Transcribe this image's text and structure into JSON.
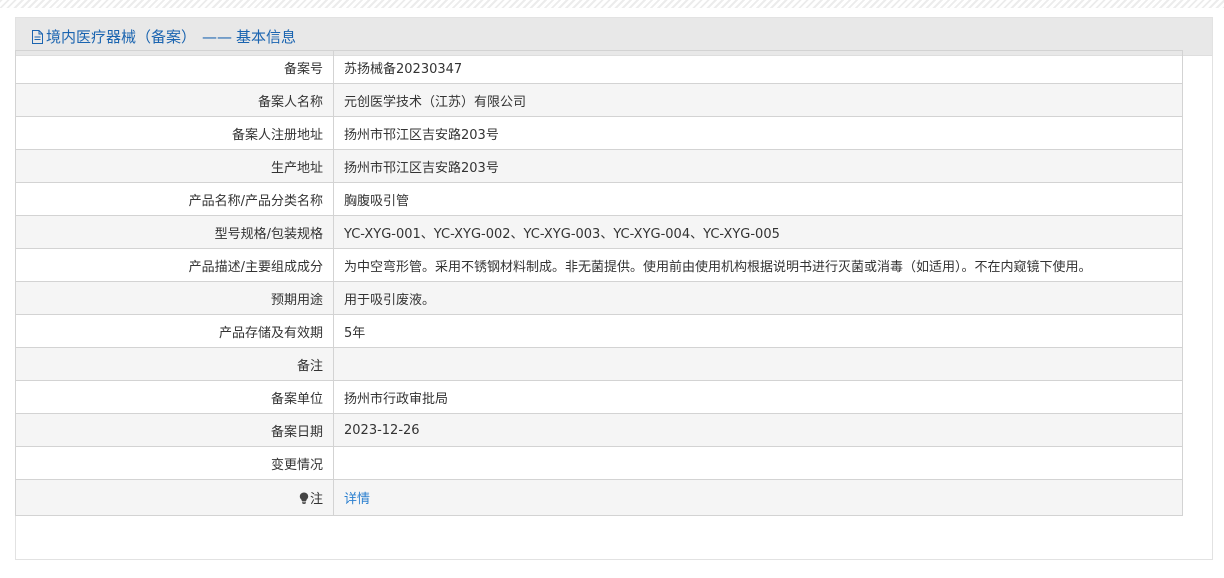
{
  "header": {
    "title": "境内医疗器械（备案）",
    "separator": "——",
    "subtitle": "基本信息"
  },
  "rows": [
    {
      "label": "备案号",
      "value": "苏扬械备20230347"
    },
    {
      "label": "备案人名称",
      "value": "元创医学技术（江苏）有限公司"
    },
    {
      "label": "备案人注册地址",
      "value": "扬州市邗江区吉安路203号"
    },
    {
      "label": "生产地址",
      "value": "扬州市邗江区吉安路203号"
    },
    {
      "label": "产品名称/产品分类名称",
      "value": "胸腹吸引管"
    },
    {
      "label": "型号规格/包装规格",
      "value": "YC-XYG-001、YC-XYG-002、YC-XYG-003、YC-XYG-004、YC-XYG-005"
    },
    {
      "label": "产品描述/主要组成成分",
      "value": "为中空弯形管。采用不锈钢材料制成。非无菌提供。使用前由使用机构根据说明书进行灭菌或消毒（如适用）。不在内窥镜下使用。"
    },
    {
      "label": "预期用途",
      "value": "用于吸引废液。"
    },
    {
      "label": "产品存储及有效期",
      "value": "5年"
    },
    {
      "label": "备注",
      "value": ""
    },
    {
      "label": "备案单位",
      "value": "扬州市行政审批局"
    },
    {
      "label": "备案日期",
      "value": "2023-12-26"
    },
    {
      "label": "变更情况",
      "value": ""
    }
  ],
  "note": {
    "label": "注",
    "link_text": "详情",
    "icon": "lightbulb-icon"
  },
  "colors": {
    "header_text": "#1a64b0",
    "link": "#2a7fcf"
  }
}
